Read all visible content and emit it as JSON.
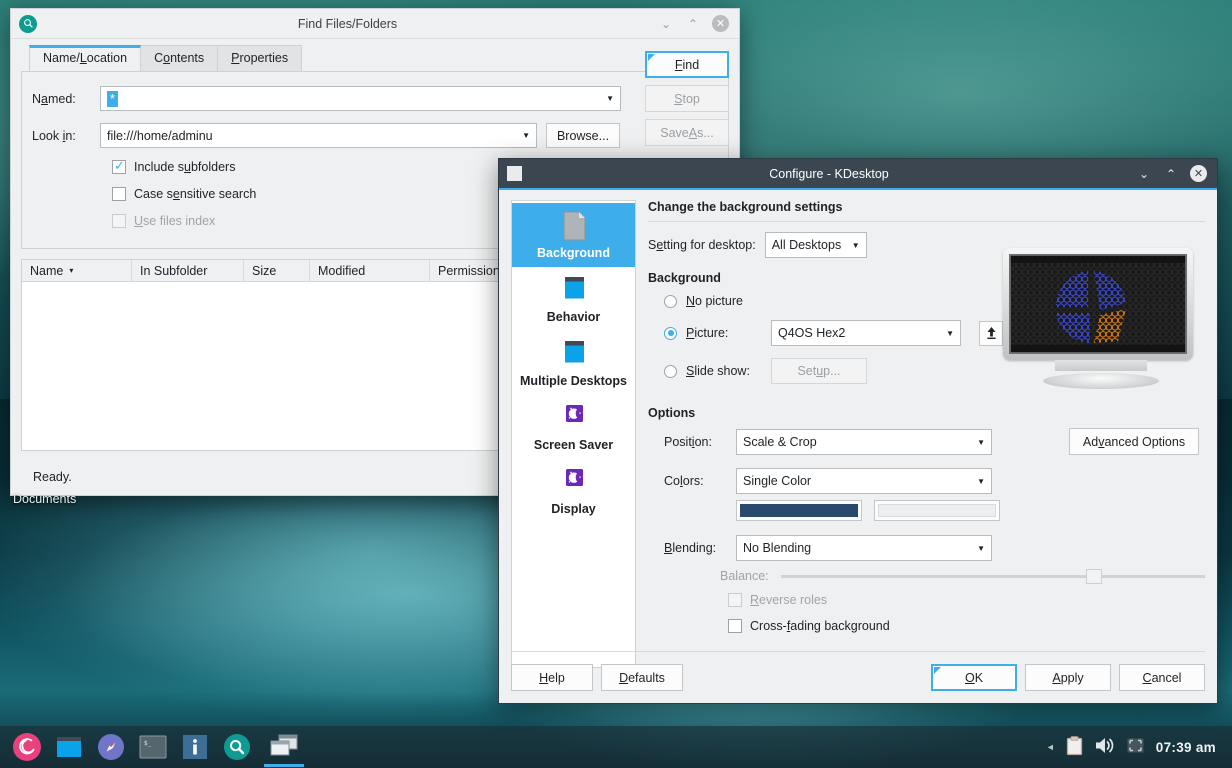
{
  "desktop": {
    "icon_label": "Documents"
  },
  "find_window": {
    "title": "Find Files/Folders",
    "app_icon": "search-icon",
    "window_controls": {
      "minimize": "⌄",
      "maximize": "⌃",
      "close": "✕"
    },
    "tabs": [
      {
        "label_pre": "Name/",
        "label_underline": "L",
        "label_post": "ocation",
        "active": true
      },
      {
        "label_pre": "C",
        "label_underline": "o",
        "label_post": "ntents",
        "active": false
      },
      {
        "label_pre": "",
        "label_underline": "P",
        "label_post": "roperties",
        "active": false
      }
    ],
    "named": {
      "label_pre": "N",
      "label_underline": "a",
      "label_post": "med:",
      "value": "*"
    },
    "look_in": {
      "label_pre": "Look ",
      "label_underline": "i",
      "label_post": "n:",
      "value": "file:///home/adminu"
    },
    "browse_button": {
      "pre": "Browse",
      "underline": "",
      "post": "..."
    },
    "checkboxes": [
      {
        "label_pre": "Include s",
        "underline": "u",
        "label_post": "bfolders",
        "checked": true,
        "enabled": true
      },
      {
        "label_pre": "Case s",
        "underline": "e",
        "label_post": "nsitive search",
        "checked": false,
        "enabled": true
      },
      {
        "label_pre": "",
        "underline": "U",
        "label_post": "se files index",
        "checked": false,
        "enabled": false
      }
    ],
    "action_buttons": [
      {
        "pre": "",
        "underline": "F",
        "post": "ind",
        "enabled": true,
        "default": true
      },
      {
        "pre": "",
        "underline": "S",
        "post": "top",
        "enabled": false,
        "default": false
      },
      {
        "pre": "Save ",
        "underline": "A",
        "post": "s...",
        "enabled": false,
        "default": false
      }
    ],
    "result_columns": [
      "Name",
      "In Subfolder",
      "Size",
      "Modified",
      "Permission"
    ],
    "sort_indicator": "▾",
    "status": "Ready."
  },
  "configure_window": {
    "title": "Configure - KDesktop",
    "window_controls": {
      "minimize": "⌄",
      "maximize": "⌃",
      "close": "✕"
    },
    "sidebar": [
      {
        "label": "Background",
        "icon": "document-page-icon",
        "selected": true
      },
      {
        "label": "Behavior",
        "icon": "window-icon",
        "selected": false
      },
      {
        "label": "Multiple Desktops",
        "icon": "window-icon",
        "selected": false
      },
      {
        "label": "Screen Saver",
        "icon": "moon-stars-icon",
        "selected": false
      },
      {
        "label": "Display",
        "icon": "moon-stars-icon",
        "selected": false
      }
    ],
    "heading": "Change the background settings",
    "setting_for_desktop": {
      "label_pre": "S",
      "underline": "e",
      "label_post": "tting for desktop:",
      "value": "All Desktops"
    },
    "background_group": {
      "title": "Background",
      "options": [
        {
          "pre": "",
          "underline": "N",
          "post": "o picture",
          "selected": false
        },
        {
          "pre": "",
          "underline": "P",
          "post": "icture:",
          "selected": true
        },
        {
          "pre": "",
          "underline": "S",
          "post": "lide show:",
          "selected": false
        }
      ],
      "picture_value": "Q4OS Hex2",
      "upload_icon": "upload-arrow-icon",
      "slideshow_button": {
        "pre": "Set",
        "underline": "u",
        "post": "p..."
      }
    },
    "options_group": {
      "title": "Options",
      "position": {
        "label_pre": "Posit",
        "underline": "i",
        "label_post": "on:",
        "value": "Scale & Crop"
      },
      "colors": {
        "label_pre": "Co",
        "underline": "l",
        "label_post": "ors:",
        "value": "Single Color"
      },
      "color_primary": "#2a4a6d",
      "color_secondary": "#eceff0",
      "blending": {
        "label_pre": "",
        "underline": "B",
        "label_post": "lending:",
        "value": "No Blending"
      },
      "balance": {
        "label": "Balance:",
        "value_percent": 72
      },
      "reverse_roles": {
        "pre": "",
        "underline": "R",
        "post": "everse roles",
        "checked": false,
        "enabled": false
      },
      "cross_fading": {
        "pre": "Cross-",
        "underline": "f",
        "post": "ading background",
        "checked": false,
        "enabled": true
      }
    },
    "advanced_button": {
      "pre": "Ad",
      "underline": "v",
      "post": "anced Options"
    },
    "footer_buttons": [
      {
        "pre": "",
        "underline": "H",
        "post": "elp",
        "default": false
      },
      {
        "pre": "",
        "underline": "D",
        "post": "efaults",
        "default": false
      },
      {
        "pre": "",
        "underline": "O",
        "post": "K",
        "default": true
      },
      {
        "pre": "",
        "underline": "A",
        "post": "pply",
        "default": false
      },
      {
        "pre": "",
        "underline": "C",
        "post": "ancel",
        "default": false
      }
    ]
  },
  "taskbar": {
    "launchers": [
      {
        "name": "debian-menu-icon"
      },
      {
        "name": "file-manager-icon"
      },
      {
        "name": "browser-compass-icon"
      },
      {
        "name": "terminal-icon"
      },
      {
        "name": "info-icon"
      },
      {
        "name": "search-icon"
      },
      {
        "name": "windows-task-icon",
        "active": true
      }
    ],
    "tray": {
      "expand_arrow": "◄",
      "items": [
        "clipboard-icon",
        "volume-icon",
        "display-icon"
      ],
      "clock": "07:39 am"
    }
  },
  "colors": {
    "accent": "#3daee9",
    "titlebar_active": "#3b4650",
    "window_bg": "#eff0f1",
    "teal_wallpaper": "#16616a"
  }
}
